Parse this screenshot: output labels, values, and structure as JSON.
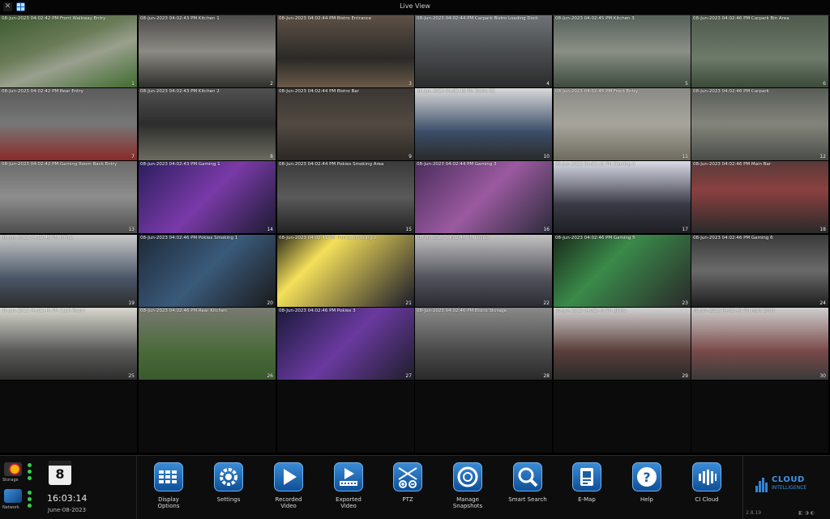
{
  "window": {
    "title": "Live View"
  },
  "cameras": [
    {
      "overlay": "08-Jun-2023 04:02:42 PM Front Walkway Entry",
      "num": "1"
    },
    {
      "overlay": "08-Jun-2023 04:02:43 PM Kitchen 1",
      "num": "2"
    },
    {
      "overlay": "08-Jun-2023 04:02:44 PM Bistro Entrance",
      "num": "3"
    },
    {
      "overlay": "08-Jun-2023 04:02:44 PM Carpark Bistro Loading Dock",
      "num": "4"
    },
    {
      "overlay": "08-Jun-2023 04:02:45 PM Kitchen 3",
      "num": "5"
    },
    {
      "overlay": "08-Jun-2023 04:02:46 PM Carpark Bin Area",
      "num": "6"
    },
    {
      "overlay": "08-Jun-2023 04:02:42 PM Rear Entry",
      "num": "7"
    },
    {
      "overlay": "08-Jun-2023 04:02:43 PM Kitchen 2",
      "num": "8"
    },
    {
      "overlay": "08-Jun-2023 04:02:44 PM Bistro Bar",
      "num": "9"
    },
    {
      "overlay": "08-Jun-2023 04:02:48 PM Bistro SE",
      "num": "10"
    },
    {
      "overlay": "08-Jun-2023 04:02:45 PM Front Entry",
      "num": "11"
    },
    {
      "overlay": "08-Jun-2023 04:02:46 PM Carpark",
      "num": "12"
    },
    {
      "overlay": "08-Jun-2023 04:02:42 PM Gaming Room Back Entry",
      "num": "13"
    },
    {
      "overlay": "08-Jun-2023 04:02:43 PM Gaming 1",
      "num": "14"
    },
    {
      "overlay": "08-Jun-2023 04:02:44 PM Pokies Smoking Area",
      "num": "15"
    },
    {
      "overlay": "08-Jun-2023 04:02:44 PM Gaming 3",
      "num": "16"
    },
    {
      "overlay": "08-Jun-2023 04:02:45 PM Gaming 4",
      "num": "17"
    },
    {
      "overlay": "08-Jun-2023 04:02:46 PM Main Bar",
      "num": "18"
    },
    {
      "overlay": "08-Jun-2023 04:02:45 PM Office",
      "num": "19"
    },
    {
      "overlay": "08-Jun-2023 04:02:46 PM Pokies Smoking 1",
      "num": "20"
    },
    {
      "overlay": "08-Jun-2023 04:02:41 PM Pokies Smoking 2",
      "num": "21"
    },
    {
      "overlay": "08-Jun-2023 04:02:48 PM Pokies",
      "num": "22"
    },
    {
      "overlay": "08-Jun-2023 04:02:46 PM Gaming 5",
      "num": "23"
    },
    {
      "overlay": "08-Jun-2023 04:02:46 PM Gaming 6",
      "num": "24"
    },
    {
      "overlay": "08-Jun-2023 04:02:46 PM Cash Room",
      "num": "25"
    },
    {
      "overlay": "08-Jun-2023 04:02:46 PM Rear Kitchen",
      "num": "26"
    },
    {
      "overlay": "08-Jun-2023 04:02:46 PM Pokies 3",
      "num": "27"
    },
    {
      "overlay": "08-Jun-2023 04:02:46 PM Bistro Storage",
      "num": "28"
    },
    {
      "overlay": "08-Jun-2023 04:02:46 PM Bistro",
      "num": "29"
    },
    {
      "overlay": "08-Jun-2023 04:02:46 PM Main Entry",
      "num": "30"
    }
  ],
  "status": {
    "storage_label": "Storage",
    "network_label": "Network"
  },
  "clock": {
    "day": "8",
    "time": "16:03:14",
    "date": "June-08-2023"
  },
  "toolbar": {
    "display_options": "Display Options",
    "settings": "Settings",
    "recorded_video": "Recorded Video",
    "exported_video": "Exported Video",
    "ptz": "PTZ",
    "manage_snapshots": "Manage Snapshots",
    "smart_search": "Smart Search",
    "emap": "E-Map",
    "help": "Help",
    "ci_cloud": "CI Cloud"
  },
  "brand": {
    "line1": "CLOUD",
    "line2": "INTELLIGENCE"
  },
  "footer": {
    "version": "2.8.19"
  },
  "colors": {
    "accent": "#1f6fc4",
    "status_ok": "#35d04d"
  }
}
